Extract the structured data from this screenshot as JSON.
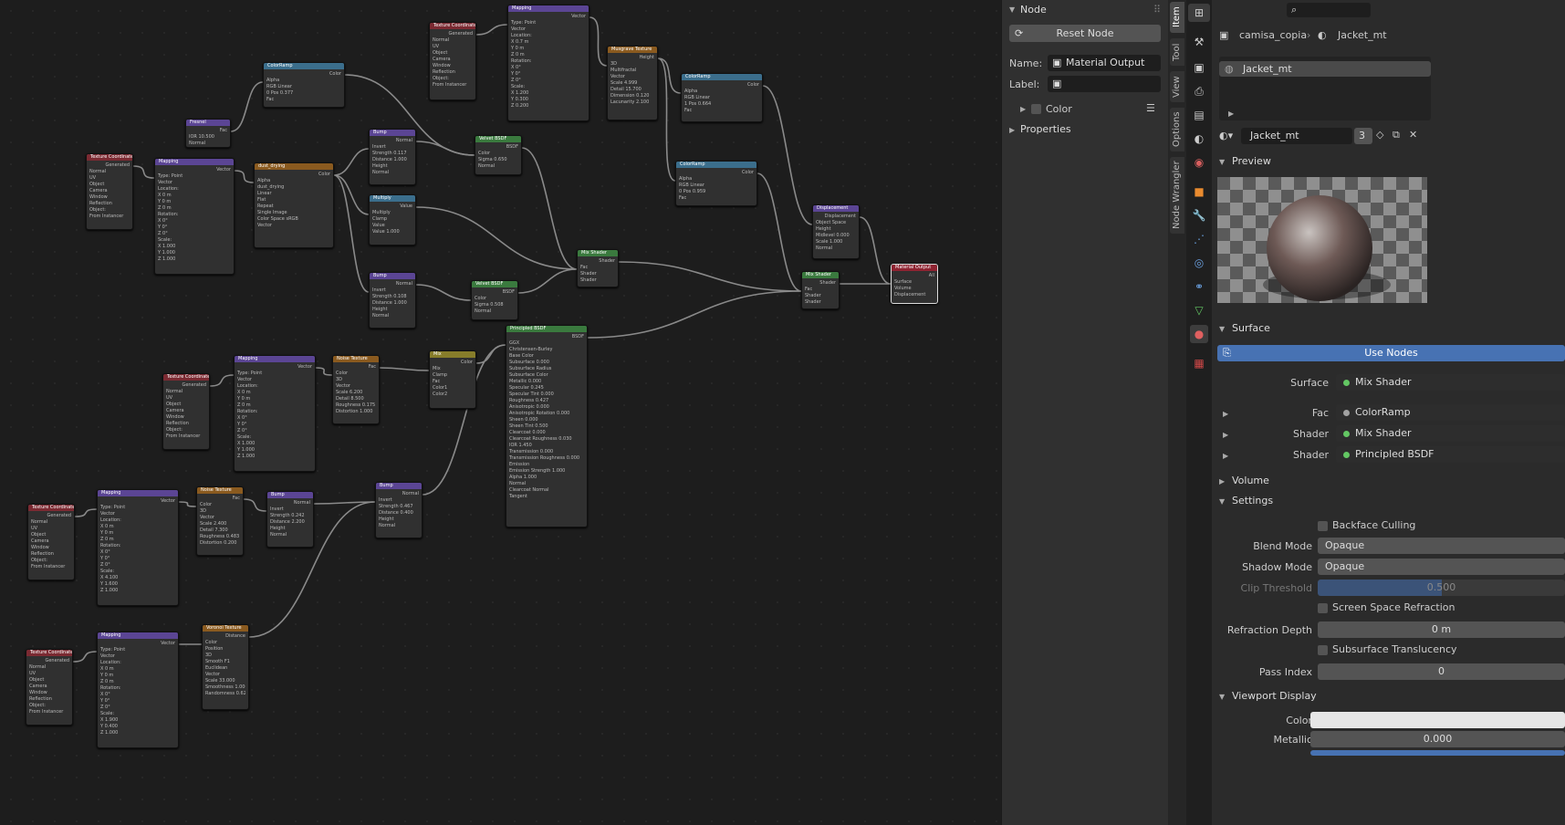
{
  "colors": {
    "accent": "#4772b3",
    "editor_bg": "#1d1d1d",
    "panel_bg": "#303030",
    "shader_socket": "#63c763",
    "texture_header": "#7b2a32",
    "vector_header": "#5b4594",
    "converter_header": "#3b6e8c",
    "shader_header": "#3a7a3e",
    "color_header": "#8a5a1f"
  },
  "node_editor": {
    "nodes": [
      {
        "title": "Texture Coordinate",
        "kind": "tex",
        "rows": [
          "Generated",
          "Normal",
          "UV",
          "Object",
          "Camera",
          "Window",
          "Reflection",
          "Object:",
          "From Instancer"
        ]
      },
      {
        "title": "Mapping",
        "kind": "vec",
        "rows": [
          "Vector",
          "Type: Point",
          "Vector",
          "Location:",
          "X 0 m",
          "Y 0 m",
          "Z 0 m",
          "Rotation:",
          "X 0°",
          "Y 0°",
          "Z 0°",
          "Scale:",
          "X 1.000",
          "Y 1.000",
          "Z 1.000"
        ]
      },
      {
        "title": "Fresnel",
        "kind": "vec",
        "rows": [
          "Fac",
          "IOR 10.500",
          "Normal"
        ]
      },
      {
        "title": "ColorRamp",
        "kind": "conv",
        "rows": [
          "Color",
          "Alpha",
          "RGB Linear",
          "0 Pos 0.377",
          "Fac"
        ]
      },
      {
        "title": "dust_drying",
        "kind": "col",
        "rows": [
          "Color",
          "Alpha",
          "dust_drying",
          "Linear",
          "Flat",
          "Repeat",
          "Single Image",
          "Color Space sRGB",
          "Vector"
        ]
      },
      {
        "title": "Bump",
        "kind": "vec",
        "rows": [
          "Normal",
          "Invert",
          "Strength 0.117",
          "Distance 1.000",
          "Height",
          "Normal"
        ]
      },
      {
        "title": "Multiply",
        "kind": "conv",
        "rows": [
          "Value",
          "Multiply",
          "Clamp",
          "Value",
          "Value 1.000"
        ]
      },
      {
        "title": "Bump",
        "kind": "vec",
        "rows": [
          "Normal",
          "Invert",
          "Strength 0.108",
          "Distance 1.000",
          "Height",
          "Normal"
        ]
      },
      {
        "title": "Texture Coordinate",
        "kind": "tex",
        "rows": [
          "Generated",
          "Normal",
          "UV",
          "Object",
          "Camera",
          "Window",
          "Reflection",
          "Object:",
          "From Instancer"
        ]
      },
      {
        "title": "Mapping",
        "kind": "vec",
        "rows": [
          "Vector",
          "Type: Point",
          "Vector",
          "Location:",
          "X 0.7 m",
          "Y 0 m",
          "Z 0 m",
          "Rotation:",
          "X 0°",
          "Y 0°",
          "Z 0°",
          "Scale:",
          "X 1.200",
          "Y 0.300",
          "Z 0.200"
        ]
      },
      {
        "title": "Musgrave Texture",
        "kind": "col",
        "rows": [
          "Height",
          "3D",
          "Multifractal",
          "Vector",
          "Scale 4.999",
          "Detail 15.700",
          "Dimension 0.120",
          "Lacunarity 2.100"
        ]
      },
      {
        "title": "Velvet BSDF",
        "kind": "shd",
        "rows": [
          "BSDF",
          "Color",
          "Sigma 0.650",
          "Normal"
        ]
      },
      {
        "title": "Velvet BSDF",
        "kind": "shd",
        "rows": [
          "BSDF",
          "Color",
          "Sigma 0.508",
          "Normal"
        ]
      },
      {
        "title": "ColorRamp",
        "kind": "conv",
        "rows": [
          "Color",
          "Alpha",
          "RGB Linear",
          "1 Pos 0.664",
          "Fac"
        ]
      },
      {
        "title": "ColorRamp",
        "kind": "conv",
        "rows": [
          "Color",
          "Alpha",
          "RGB Linear",
          "0 Pos 0.959",
          "Fac"
        ]
      },
      {
        "title": "Mix Shader",
        "kind": "shd",
        "rows": [
          "Shader",
          "Fac",
          "Shader",
          "Shader"
        ]
      },
      {
        "title": "Displacement",
        "kind": "vec",
        "rows": [
          "Displacement",
          "Object Space",
          "Height",
          "Midlevel 0.000",
          "Scale 1.000",
          "Normal"
        ]
      },
      {
        "title": "Mix Shader",
        "kind": "shd",
        "rows": [
          "Shader",
          "Fac",
          "Shader",
          "Shader"
        ]
      },
      {
        "title": "Material Output",
        "kind": "out",
        "rows": [
          "All",
          "Surface",
          "Volume",
          "Displacement"
        ]
      },
      {
        "title": "Principled BSDF",
        "kind": "shd",
        "rows": [
          "BSDF",
          "GGX",
          "Christensen-Burley",
          "Base Color",
          "Subsurface 0.000",
          "Subsurface Radius",
          "Subsurface Color",
          "Metallic 0.000",
          "Specular 0.245",
          "Specular Tint 0.000",
          "Roughness 0.427",
          "Anisotropic 0.000",
          "Anisotropic Rotation 0.000",
          "Sheen 0.000",
          "Sheen Tint 0.500",
          "Clearcoat 0.000",
          "Clearcoat Roughness 0.030",
          "IOR 1.450",
          "Transmission 0.000",
          "Transmission Roughness 0.000",
          "Emission",
          "Emission Strength 1.000",
          "Alpha 1.000",
          "Normal",
          "Clearcoat Normal",
          "Tangent"
        ]
      },
      {
        "title": "Texture Coordinate",
        "kind": "tex",
        "rows": [
          "Generated",
          "Normal",
          "UV",
          "Object",
          "Camera",
          "Window",
          "Reflection",
          "Object:",
          "From Instancer"
        ]
      },
      {
        "title": "Mapping",
        "kind": "vec",
        "rows": [
          "Vector",
          "Type: Point",
          "Vector",
          "Location:",
          "X 0 m",
          "Y 0 m",
          "Z 0 m",
          "Rotation:",
          "X 0°",
          "Y 0°",
          "Z 0°",
          "Scale:",
          "X 1.000",
          "Y 1.000",
          "Z 1.000"
        ]
      },
      {
        "title": "Noise Texture",
        "kind": "col",
        "rows": [
          "Fac",
          "Color",
          "3D",
          "Vector",
          "Scale 6.200",
          "Detail 8.500",
          "Roughness 0.175",
          "Distortion 1.000"
        ]
      },
      {
        "title": "Mix",
        "kind": "mix",
        "rows": [
          "Color",
          "Mix",
          "Clamp",
          "Fac",
          "Color1",
          "Color2"
        ]
      },
      {
        "title": "Texture Coordinate",
        "kind": "tex",
        "rows": [
          "Generated",
          "Normal",
          "UV",
          "Object",
          "Camera",
          "Window",
          "Reflection",
          "Object:",
          "From Instancer"
        ]
      },
      {
        "title": "Mapping",
        "kind": "vec",
        "rows": [
          "Vector",
          "Type: Point",
          "Vector",
          "Location:",
          "X 0 m",
          "Y 0 m",
          "Z 0 m",
          "Rotation:",
          "X 0°",
          "Y 0°",
          "Z 0°",
          "Scale:",
          "X 4.100",
          "Y 1.600",
          "Z 1.000"
        ]
      },
      {
        "title": "Noise Texture",
        "kind": "col",
        "rows": [
          "Fac",
          "Color",
          "3D",
          "Vector",
          "Scale 2.400",
          "Detail 7.300",
          "Roughness 0.483",
          "Distortion 0.200"
        ]
      },
      {
        "title": "Bump",
        "kind": "vec",
        "rows": [
          "Normal",
          "Invert",
          "Strength 0.242",
          "Distance 2.200",
          "Height",
          "Normal"
        ]
      },
      {
        "title": "Bump",
        "kind": "vec",
        "rows": [
          "Normal",
          "Invert",
          "Strength 0.467",
          "Distance 0.400",
          "Height",
          "Normal"
        ]
      },
      {
        "title": "Texture Coordinate",
        "kind": "tex",
        "rows": [
          "Generated",
          "Normal",
          "UV",
          "Object",
          "Camera",
          "Window",
          "Reflection",
          "Object:",
          "From Instancer"
        ]
      },
      {
        "title": "Mapping",
        "kind": "vec",
        "rows": [
          "Vector",
          "Type: Point",
          "Vector",
          "Location:",
          "X 0 m",
          "Y 0 m",
          "Z 0 m",
          "Rotation:",
          "X 0°",
          "Y 0°",
          "Z 0°",
          "Scale:",
          "X 1.900",
          "Y 0.400",
          "Z 1.000"
        ]
      },
      {
        "title": "Voronoi Texture",
        "kind": "col",
        "rows": [
          "Distance",
          "Color",
          "Position",
          "3D",
          "Smooth F1",
          "Euclidean",
          "Vector",
          "Scale 33.000",
          "Smoothness 1.000",
          "Randomness 0.625"
        ]
      }
    ]
  },
  "npanel": {
    "header": "Node",
    "reset_label": "Reset Node",
    "name_label": "Name:",
    "name_value": "Material Output",
    "label_label": "Label:",
    "label_value": "",
    "color_label": "Color",
    "properties_label": "Properties"
  },
  "side_tabs": [
    "Item",
    "Tool",
    "View",
    "Options",
    "Node Wrangler"
  ],
  "properties": {
    "search_placeholder": "",
    "object_name": "camisa_copia",
    "material_crumb": "Jacket_mt",
    "slot_item": "Jacket_mt",
    "material_name": "Jacket_mt",
    "user_count": "3",
    "preview_header": "Preview",
    "surface_header": "Surface",
    "use_nodes_label": "Use Nodes",
    "surface_rows": [
      {
        "label": "Surface",
        "value": "Mix Shader"
      },
      {
        "label": "Fac",
        "value": "ColorRamp"
      },
      {
        "label": "Shader",
        "value": "Mix Shader"
      },
      {
        "label": "Shader",
        "value": "Principled BSDF"
      }
    ],
    "volume_header": "Volume",
    "settings_header": "Settings",
    "backface_label": "Backface Culling",
    "blend_label": "Blend Mode",
    "blend_value": "Opaque",
    "shadow_label": "Shadow Mode",
    "shadow_value": "Opaque",
    "clip_label": "Clip Threshold",
    "clip_value": "0.500",
    "ssr_label": "Screen Space Refraction",
    "refr_label": "Refraction Depth",
    "refr_value": "0 m",
    "sss_label": "Subsurface Translucency",
    "pass_label": "Pass Index",
    "pass_value": "0",
    "viewport_header": "Viewport Display",
    "vp_color_label": "Color",
    "metallic_label": "Metallic",
    "metallic_value": "0.000"
  }
}
